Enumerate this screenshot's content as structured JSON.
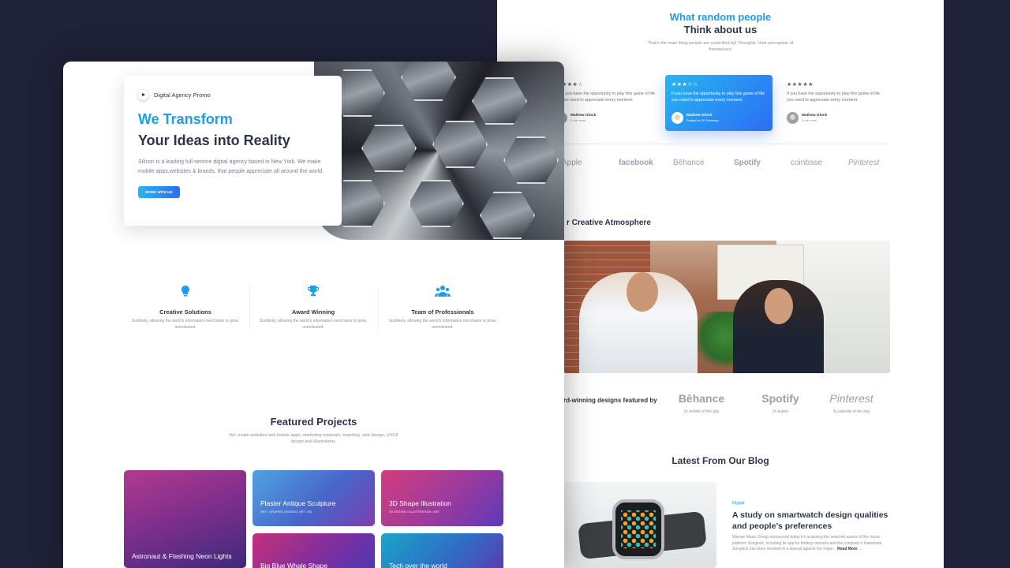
{
  "testimonials": {
    "title_line1": "What random people",
    "title_line2": "Think about us",
    "subtitle": "That's the main thing people are controlled by! Thoughts- their perception of themselves!",
    "cards": [
      {
        "stars": "★★★☆",
        "quote": "If you have the opportunity to play this game of life you need to appreciate every moment.",
        "name": "Mathew Glock",
        "time": "5 min read"
      },
      {
        "stars": "★★★☆☆",
        "quote": "If you have the opportunity to play this game of life you need to appreciate every moment.",
        "name": "Mathew Glock",
        "time": "Posted on 20 February"
      },
      {
        "stars": "★★★★★",
        "quote": "If you have the opportunity to play this game of life you need to appreciate every moment.",
        "name": "Mathew Glock",
        "time": "5 min read"
      }
    ]
  },
  "logos": [
    "Apple",
    "facebook",
    "Bēhance",
    "Spotify",
    "coinbase",
    "Pinterest"
  ],
  "atmosphere_title": "r Creative Atmosphere",
  "featured": {
    "label": "rd-winning designs featured by",
    "items": [
      {
        "logo": "Bēhance",
        "sub": "3x mobile of the day"
      },
      {
        "logo": "Spotify",
        "sub": "2x kudos"
      },
      {
        "logo": "Pinterest",
        "sub": "3x website of the day"
      }
    ]
  },
  "blog": {
    "title": "Latest From Our Blog",
    "category": "Digital",
    "headline": "A study on smartwatch design qualities and people’s preferences",
    "excerpt": "Warner Music Group announced today it’s acquiring the selected assets of the music platform Songkick, including its app for finding concerts and the company’s trademark. Songkick has been involved in a lawsuit against the major...",
    "read_more": "Read More →"
  },
  "hero": {
    "promo": "Digital Agency Promo",
    "title_line1": "We Transform",
    "title_line2": "Your Ideas into Reality",
    "description": "Silicon is a leading full-service digital agency based in New York. We make mobile apps,websites & brands, that people appreciate all around the world.",
    "button": "WORK WITH US"
  },
  "features": [
    {
      "icon": "lightbulb-icon",
      "title": "Creative Solutions",
      "desc": "Suddenly, allowing the world's information merchants to grow, unmolested."
    },
    {
      "icon": "trophy-icon",
      "title": "Award Winning",
      "desc": "Suddenly, allowing the world's information merchants to grow, unmolested."
    },
    {
      "icon": "team-icon",
      "title": "Team of Professionals",
      "desc": "Suddenly, allowing the world's information merchants to grow, unmolested."
    }
  ],
  "projects": {
    "title": "Featured Projects",
    "subtitle": "We create websites and mobile apps, marketing materials, branding, web design, UX/UI design and illustrations.",
    "cards": [
      {
        "title": "Astronaut & Flashing Neon Lights",
        "meta": ""
      },
      {
        "title": "Plaster Antique Sculpture",
        "meta": "ART / GRAPHIC DESIGN / ART / 3D"
      },
      {
        "title": "3D Shape Illustration",
        "meta": "3D DESIGN / ILLUSTRATION / ART"
      },
      {
        "title": "Big Blue Whale Shape",
        "meta": ""
      },
      {
        "title": "Tech over the world",
        "meta": ""
      }
    ]
  },
  "colors": {
    "accent": "#1e9ee6",
    "accent_gradient_end": "#2d6df4",
    "dark_text": "#2d3548",
    "background": "#1f2238"
  }
}
